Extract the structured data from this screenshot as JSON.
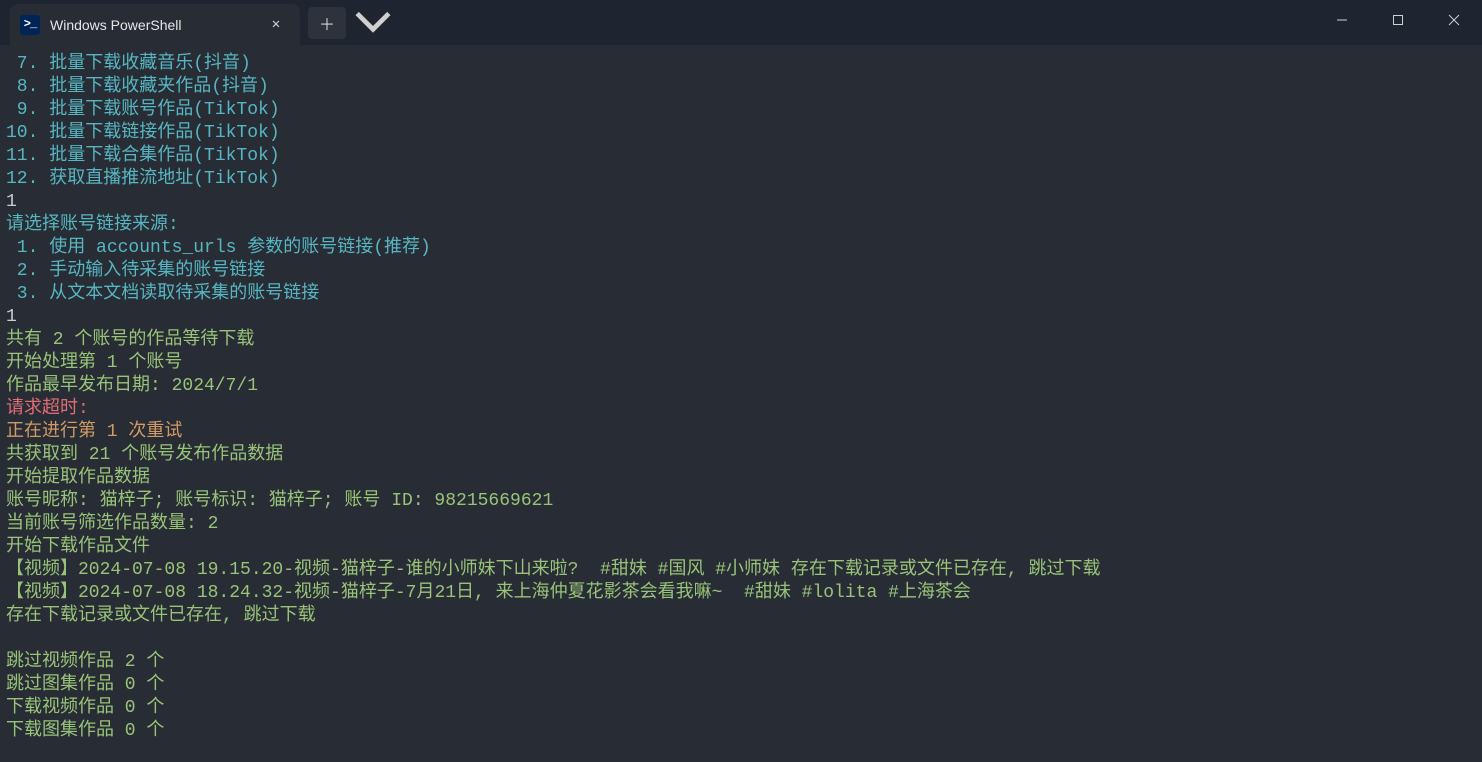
{
  "titlebar": {
    "tab_title": "Windows PowerShell"
  },
  "menu": {
    "items": [
      {
        "num": " 7. ",
        "text": "批量下载收藏音乐(抖音)"
      },
      {
        "num": " 8. ",
        "text": "批量下载收藏夹作品(抖音)"
      },
      {
        "num": " 9. ",
        "text": "批量下载账号作品(TikTok)"
      },
      {
        "num": "10. ",
        "text": "批量下载链接作品(TikTok)"
      },
      {
        "num": "11. ",
        "text": "批量下载合集作品(TikTok)"
      },
      {
        "num": "12. ",
        "text": "获取直播推流地址(TikTok)"
      }
    ]
  },
  "inputs": {
    "first": "1",
    "second": "1"
  },
  "source_prompt": "请选择账号链接来源:",
  "sources": [
    {
      "num": " 1. ",
      "text": "使用 accounts_urls 参数的账号链接(推荐)"
    },
    {
      "num": " 2. ",
      "text": "手动输入待采集的账号链接"
    },
    {
      "num": " 3. ",
      "text": "从文本文档读取待采集的账号链接"
    }
  ],
  "status": {
    "total": "共有 2 个账号的作品等待下载",
    "start1": "开始处理第 1 个账号",
    "earliest": "作品最早发布日期: 2024/7/1",
    "timeout": "请求超时:",
    "retry": "正在进行第 1 次重试",
    "fetched": "共获取到 21 个账号发布作品数据",
    "extract": "开始提取作品数据",
    "account": "账号昵称: 猫梓子; 账号标识: 猫梓子; 账号 ID: 98215669621",
    "filtered": "当前账号筛选作品数量: 2",
    "dlstart": "开始下载作品文件",
    "vid1": "【视频】2024-07-08 19.15.20-视频-猫梓子-谁的小师妹下山来啦?  #甜妹 #国风 #小师妹 存在下载记录或文件已存在, 跳过下载",
    "vid2a": "【视频】2024-07-08 18.24.32-视频-猫梓子-7月21日, 来上海仲夏花影茶会看我嘛~  #甜妹 #lolita #上海茶会",
    "vid2b": "存在下载记录或文件已存在, 跳过下载",
    "blank": "",
    "skip_vid": "跳过视频作品 2 个",
    "skip_img": "跳过图集作品 0 个",
    "dl_vid": "下载视频作品 0 个",
    "dl_img": "下载图集作品 0 个"
  }
}
